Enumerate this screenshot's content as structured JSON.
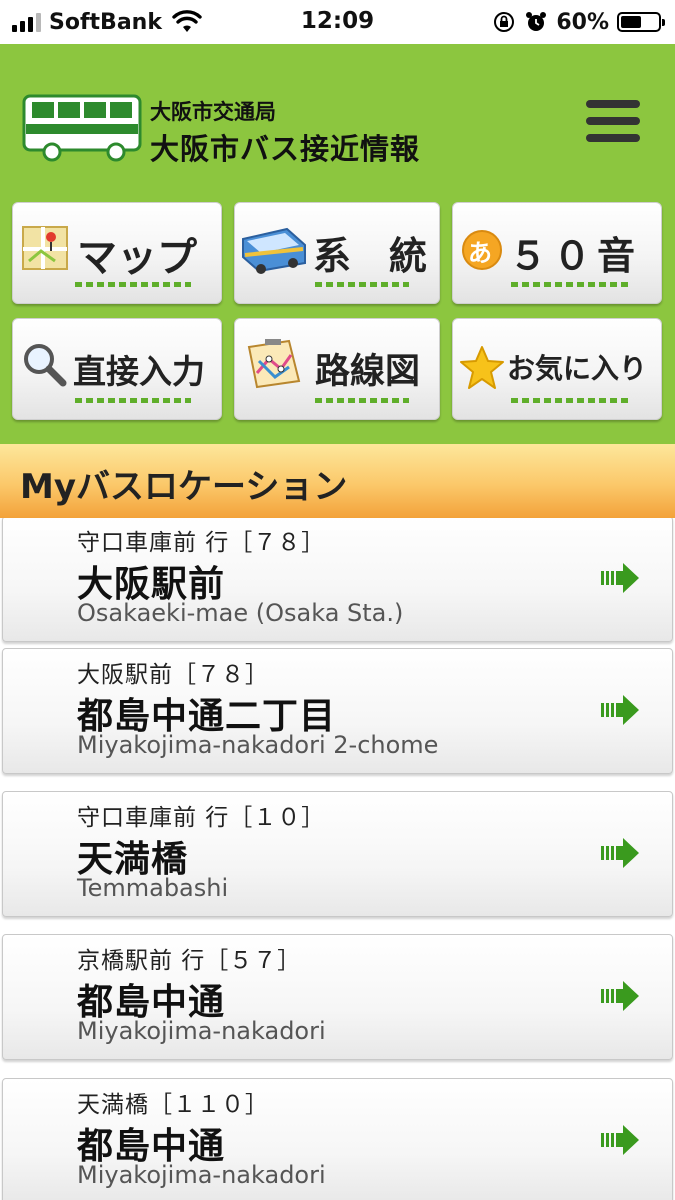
{
  "status_bar": {
    "carrier": "SoftBank",
    "time": "12:09",
    "battery_percent": "60%",
    "battery_level": 0.6,
    "icons": [
      "signal-icon",
      "wifi-icon",
      "orientation-lock-icon",
      "alarm-icon",
      "battery-icon"
    ]
  },
  "header": {
    "org_name": "大阪市交通局",
    "service_name": "大阪市バス接近情報",
    "logo_icon": "bus-logo-icon",
    "menu_icon": "hamburger-menu-icon"
  },
  "nav": {
    "map": "マップ",
    "route": "系　統",
    "kana": "５０音",
    "direct_input": "直接入力",
    "route_map": "路線図",
    "favorites": "お気に入り",
    "kana_badge": "あ"
  },
  "section": {
    "title": "Myバスロケーション"
  },
  "locations": [
    {
      "route": "守口車庫前 行［７８］",
      "stop": "大阪駅前",
      "romaji": "Osakaeki-mae (Osaka Sta.)"
    },
    {
      "route": "大阪駅前［７８］",
      "stop": "都島中通二丁目",
      "romaji": "Miyakojima-nakadori 2-chome"
    },
    {
      "route": "守口車庫前 行［１０］",
      "stop": "天満橋",
      "romaji": "Temmabashi"
    },
    {
      "route": "京橋駅前 行［５７］",
      "stop": "都島中通",
      "romaji": "Miyakojima-nakadori"
    },
    {
      "route": "天満橋［１１０］",
      "stop": "都島中通",
      "romaji": "Miyakojima-nakadori"
    }
  ],
  "colors": {
    "header_green": "#8cc63f",
    "accent_green": "#5fae2a",
    "section_orange": "#f3a23a"
  }
}
